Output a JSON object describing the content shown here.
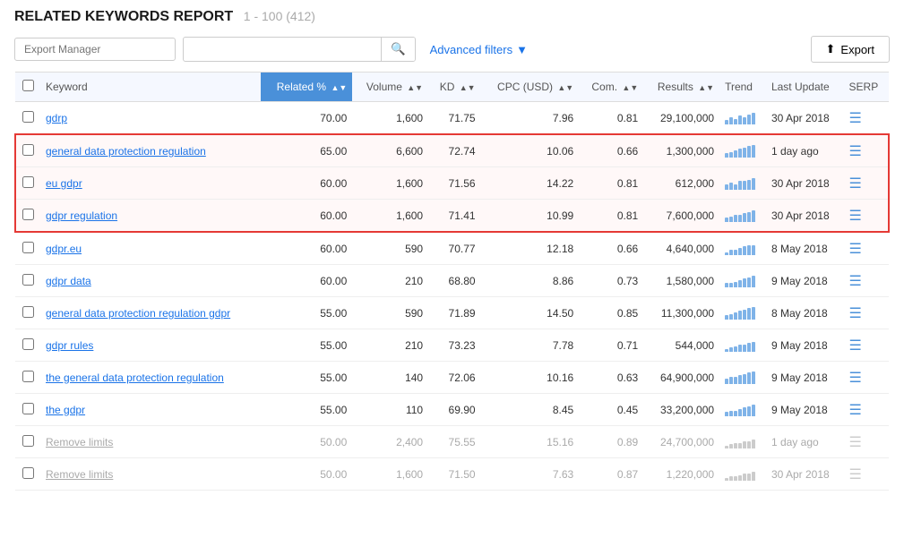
{
  "title": "RELATED KEYWORDS REPORT",
  "pagination": "1 - 100 (412)",
  "toolbar": {
    "export_manager_placeholder": "Export Manager",
    "search_placeholder": "",
    "advanced_filters_label": "Advanced filters",
    "export_btn_label": "Export"
  },
  "columns": [
    {
      "id": "keyword",
      "label": "Keyword",
      "sorted": false
    },
    {
      "id": "related",
      "label": "Related %",
      "sorted": true
    },
    {
      "id": "volume",
      "label": "Volume",
      "sorted": false
    },
    {
      "id": "kd",
      "label": "KD",
      "sorted": false
    },
    {
      "id": "cpc",
      "label": "CPC (USD)",
      "sorted": false
    },
    {
      "id": "com",
      "label": "Com.",
      "sorted": false
    },
    {
      "id": "results",
      "label": "Results",
      "sorted": false
    },
    {
      "id": "trend",
      "label": "Trend",
      "sorted": false
    },
    {
      "id": "lastupdate",
      "label": "Last Update",
      "sorted": false
    },
    {
      "id": "serp",
      "label": "SERP",
      "sorted": false
    }
  ],
  "rows": [
    {
      "keyword": "gdrp",
      "related": "70.00",
      "volume": "1,600",
      "kd": "71.75",
      "cpc": "7.96",
      "com": "0.81",
      "results": "29,100,000",
      "lastupdate": "30 Apr 2018",
      "highlight": false,
      "dim": false,
      "trendHeights": [
        3,
        5,
        4,
        6,
        5,
        7,
        8
      ]
    },
    {
      "keyword": "general data protection regulation",
      "related": "65.00",
      "volume": "6,600",
      "kd": "72.74",
      "cpc": "10.06",
      "com": "0.66",
      "results": "1,300,000",
      "lastupdate": "1 day ago",
      "highlight": true,
      "dim": false,
      "trendHeights": [
        3,
        4,
        5,
        6,
        7,
        8,
        9
      ]
    },
    {
      "keyword": "eu gdpr",
      "related": "60.00",
      "volume": "1,600",
      "kd": "71.56",
      "cpc": "14.22",
      "com": "0.81",
      "results": "612,000",
      "lastupdate": "30 Apr 2018",
      "highlight": true,
      "dim": false,
      "trendHeights": [
        4,
        5,
        4,
        6,
        6,
        7,
        8
      ]
    },
    {
      "keyword": "gdpr regulation",
      "related": "60.00",
      "volume": "1,600",
      "kd": "71.41",
      "cpc": "10.99",
      "com": "0.81",
      "results": "7,600,000",
      "lastupdate": "30 Apr 2018",
      "highlight": true,
      "dim": false,
      "trendHeights": [
        3,
        4,
        5,
        5,
        6,
        7,
        8
      ]
    },
    {
      "keyword": "gdpr.eu",
      "related": "60.00",
      "volume": "590",
      "kd": "70.77",
      "cpc": "12.18",
      "com": "0.66",
      "results": "4,640,000",
      "lastupdate": "8 May 2018",
      "highlight": false,
      "dim": false,
      "trendHeights": [
        2,
        4,
        4,
        5,
        6,
        7,
        7
      ]
    },
    {
      "keyword": "gdpr data",
      "related": "60.00",
      "volume": "210",
      "kd": "68.80",
      "cpc": "8.86",
      "com": "0.73",
      "results": "1,580,000",
      "lastupdate": "9 May 2018",
      "highlight": false,
      "dim": false,
      "trendHeights": [
        3,
        3,
        4,
        5,
        6,
        7,
        8
      ]
    },
    {
      "keyword": "general data protection regulation gdpr",
      "related": "55.00",
      "volume": "590",
      "kd": "71.89",
      "cpc": "14.50",
      "com": "0.85",
      "results": "11,300,000",
      "lastupdate": "8 May 2018",
      "highlight": false,
      "dim": false,
      "trendHeights": [
        3,
        4,
        5,
        6,
        7,
        8,
        9
      ]
    },
    {
      "keyword": "gdpr rules",
      "related": "55.00",
      "volume": "210",
      "kd": "73.23",
      "cpc": "7.78",
      "com": "0.71",
      "results": "544,000",
      "lastupdate": "9 May 2018",
      "highlight": false,
      "dim": false,
      "trendHeights": [
        2,
        3,
        4,
        5,
        5,
        6,
        7
      ]
    },
    {
      "keyword": "the general data protection regulation",
      "related": "55.00",
      "volume": "140",
      "kd": "72.06",
      "cpc": "10.16",
      "com": "0.63",
      "results": "64,900,000",
      "lastupdate": "9 May 2018",
      "highlight": false,
      "dim": false,
      "trendHeights": [
        4,
        5,
        5,
        6,
        7,
        8,
        9
      ]
    },
    {
      "keyword": "the gdpr",
      "related": "55.00",
      "volume": "110",
      "kd": "69.90",
      "cpc": "8.45",
      "com": "0.45",
      "results": "33,200,000",
      "lastupdate": "9 May 2018",
      "highlight": false,
      "dim": false,
      "trendHeights": [
        3,
        4,
        4,
        5,
        6,
        7,
        8
      ]
    },
    {
      "keyword": "Remove limits",
      "related": "50.00",
      "volume": "2,400",
      "kd": "75.55",
      "cpc": "15.16",
      "com": "0.89",
      "results": "24,700,000",
      "lastupdate": "1 day ago",
      "highlight": false,
      "dim": true,
      "trendHeights": [
        2,
        3,
        4,
        4,
        5,
        5,
        6
      ]
    },
    {
      "keyword": "Remove limits",
      "related": "50.00",
      "volume": "1,600",
      "kd": "71.50",
      "cpc": "7.63",
      "com": "0.87",
      "results": "1,220,000",
      "lastupdate": "30 Apr 2018",
      "highlight": false,
      "dim": true,
      "trendHeights": [
        2,
        3,
        3,
        4,
        5,
        5,
        6
      ]
    }
  ]
}
